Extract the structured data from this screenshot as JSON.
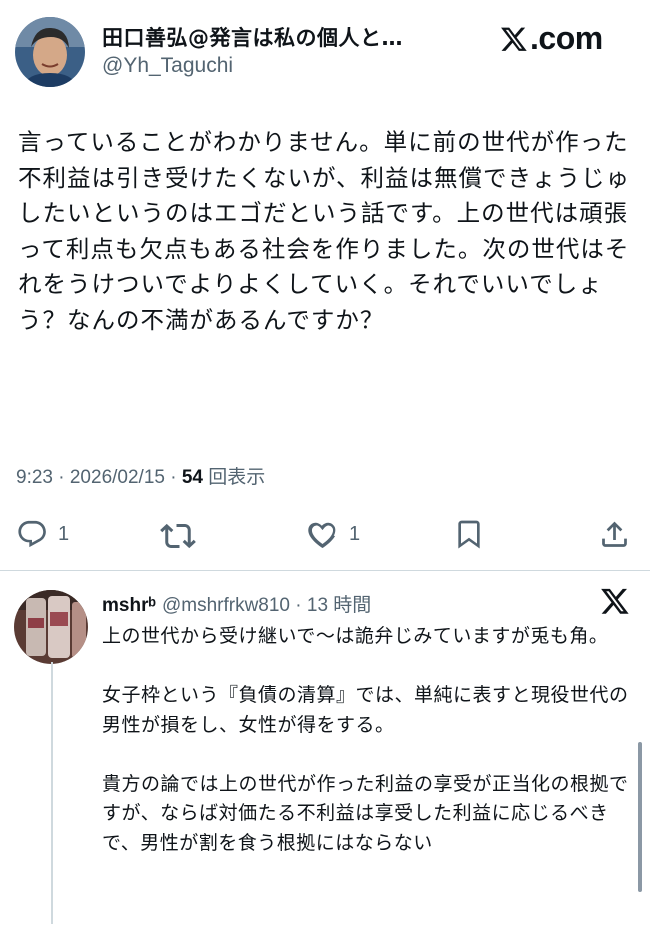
{
  "tweet": {
    "author_name": "田口善弘@発言は私の個人と…",
    "author_handle": "@Yh_Taguchi",
    "site_logo": "𝕏.com",
    "site_logo_text": ".com",
    "text": "言っていることがわかりません。単に前の世代が作った不利益は引き受けたくないが、利益は無償できょうじゅしたいというのはエゴだという話です。上の世代は頑張って利点も欠点もある社会を作りました。次の世代はそれをうけついでよりよくしていく。それでいいでしょう？なんの不満があるんですか？",
    "meta_prefix": "9:23 · 2026/02/15 · ",
    "views_count": "54",
    "views_label": "回表示",
    "reply_count": "1",
    "like_count": "1"
  },
  "reply": {
    "author_name": "mshrᵇ",
    "author_handle": "@mshrfrkw810",
    "time": "13 時間",
    "paragraphs": [
      "上の世代から受け継いで〜は詭弁じみていますが兎も角。",
      "女子枠という『負債の清算』では、単純に表すと現役世代の男性が損をし、女性が得をする。",
      "貴方の論では上の世代が作った利益の享受が正当化の根拠ですが、ならば対価たる不利益は享受した利益に応じるべきで、男性が割を食う根拠にはならない"
    ]
  },
  "icons": [
    "x-logo-icon",
    "reply-icon",
    "retweet-icon",
    "like-icon",
    "bookmark-icon",
    "share-icon",
    "close-x-icon"
  ],
  "colors": {
    "text": "#0f1419",
    "muted": "#536471",
    "divider": "#cfd9de"
  }
}
